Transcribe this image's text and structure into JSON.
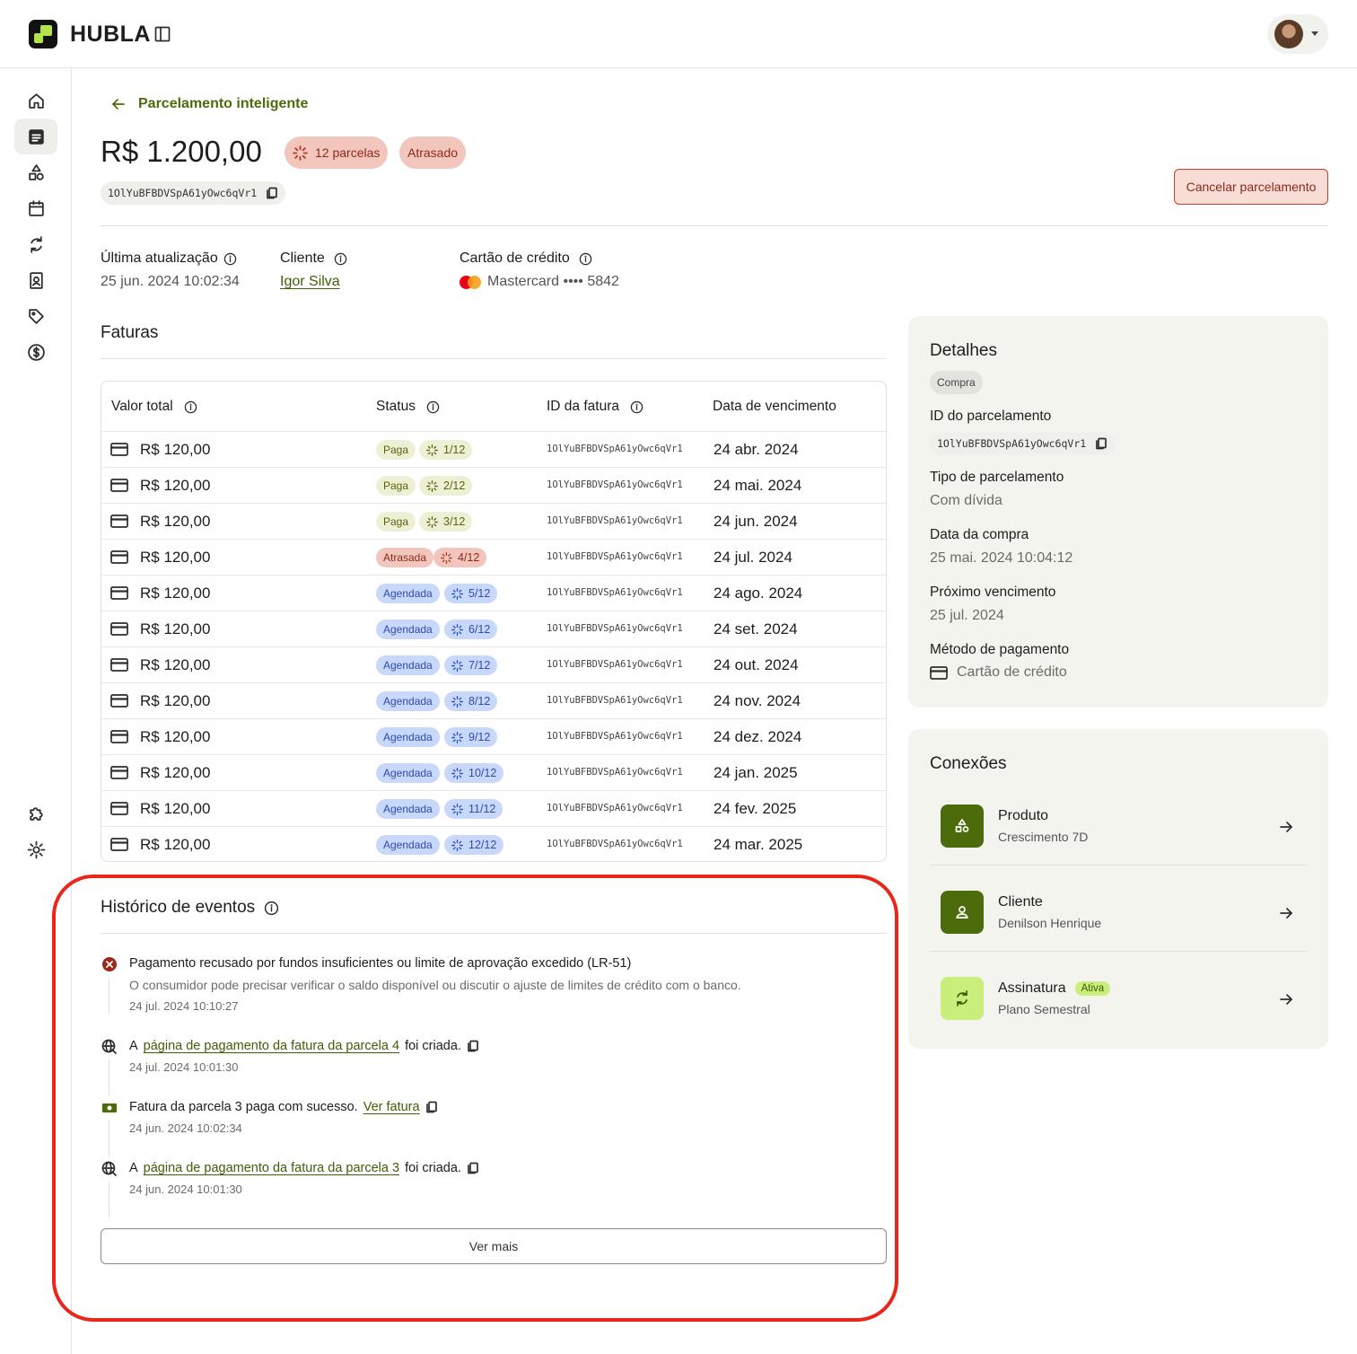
{
  "app": {
    "brand": "HUBLA",
    "logo_color": "#b4e24c"
  },
  "header": {
    "back_label": "Parcelamento inteligente",
    "amount": "R$ 1.200,00",
    "installments_badge": "12 parcelas",
    "status_badge": "Atrasado",
    "id": "1OlYuBFBDVSpA61yOwc6qVr1",
    "cancel_label": "Cancelar parcelamento"
  },
  "meta": {
    "last_update_label": "Última atualização",
    "last_update_value": "25 jun. 2024 10:02:34",
    "client_label": "Cliente",
    "client_value": "Igor Silva",
    "card_label": "Cartão de crédito",
    "card_value": "Mastercard •••• 5842"
  },
  "invoices": {
    "title": "Faturas",
    "headers": [
      "Valor total",
      "Status",
      "ID da fatura",
      "Data de vencimento"
    ],
    "rows": [
      {
        "value": "R$ 120,00",
        "status": "Paga",
        "kind": "paga",
        "parcel": "1/12",
        "id": "1OlYuBFBDVSpA61yOwc6qVr1",
        "due": "24 abr. 2024"
      },
      {
        "value": "R$ 120,00",
        "status": "Paga",
        "kind": "paga",
        "parcel": "2/12",
        "id": "1OlYuBFBDVSpA61yOwc6qVr1",
        "due": "24 mai. 2024"
      },
      {
        "value": "R$ 120,00",
        "status": "Paga",
        "kind": "paga",
        "parcel": "3/12",
        "id": "1OlYuBFBDVSpA61yOwc6qVr1",
        "due": "24 jun. 2024"
      },
      {
        "value": "R$ 120,00",
        "status": "Atrasada",
        "kind": "atr",
        "parcel": "4/12",
        "id": "1OlYuBFBDVSpA61yOwc6qVr1",
        "due": "24 jul. 2024"
      },
      {
        "value": "R$ 120,00",
        "status": "Agendada",
        "kind": "ag",
        "parcel": "5/12",
        "id": "1OlYuBFBDVSpA61yOwc6qVr1",
        "due": "24 ago. 2024"
      },
      {
        "value": "R$ 120,00",
        "status": "Agendada",
        "kind": "ag",
        "parcel": "6/12",
        "id": "1OlYuBFBDVSpA61yOwc6qVr1",
        "due": "24 set. 2024"
      },
      {
        "value": "R$ 120,00",
        "status": "Agendada",
        "kind": "ag",
        "parcel": "7/12",
        "id": "1OlYuBFBDVSpA61yOwc6qVr1",
        "due": "24 out. 2024"
      },
      {
        "value": "R$ 120,00",
        "status": "Agendada",
        "kind": "ag",
        "parcel": "8/12",
        "id": "1OlYuBFBDVSpA61yOwc6qVr1",
        "due": "24 nov. 2024"
      },
      {
        "value": "R$ 120,00",
        "status": "Agendada",
        "kind": "ag",
        "parcel": "9/12",
        "id": "1OlYuBFBDVSpA61yOwc6qVr1",
        "due": "24 dez. 2024"
      },
      {
        "value": "R$ 120,00",
        "status": "Agendada",
        "kind": "ag",
        "parcel": "10/12",
        "id": "1OlYuBFBDVSpA61yOwc6qVr1",
        "due": "24 jan. 2025"
      },
      {
        "value": "R$ 120,00",
        "status": "Agendada",
        "kind": "ag",
        "parcel": "11/12",
        "id": "1OlYuBFBDVSpA61yOwc6qVr1",
        "due": "24 fev. 2025"
      },
      {
        "value": "R$ 120,00",
        "status": "Agendada",
        "kind": "ag",
        "parcel": "12/12",
        "id": "1OlYuBFBDVSpA61yOwc6qVr1",
        "due": "24 mar. 2025"
      }
    ]
  },
  "history": {
    "title": "Histórico de eventos",
    "e1_text": "Pagamento recusado por fundos insuficientes ou limite de aprovação excedido (LR-51)",
    "e1_sub": "O consumidor pode precisar verificar o saldo disponível ou discutir o ajuste de limites de crédito com o banco.",
    "e1_time": "24 jul. 2024 10:10:27",
    "e2_pre": "A",
    "e2_link": "página de pagamento da fatura da parcela 4",
    "e2_post": "foi criada.",
    "e2_time": "24 jul. 2024 10:01:30",
    "e3_pre": "Fatura da parcela 3 paga com sucesso.",
    "e3_link": "Ver fatura",
    "e3_time": "24 jun. 2024 10:02:34",
    "e4_pre": "A",
    "e4_link": "página de pagamento da fatura da parcela 3",
    "e4_post": "foi criada.",
    "e4_time": "24 jun. 2024 10:01:30",
    "more_label": "Ver mais"
  },
  "details": {
    "title": "Detalhes",
    "chip": "Compra",
    "id_label": "ID do parcelamento",
    "id_value": "1OlYuBFBDVSpA61yOwc6qVr1",
    "type_label": "Tipo de parcelamento",
    "type_value": "Com dívida",
    "purchase_label": "Data da compra",
    "purchase_value": "25 mai. 2024 10:04:12",
    "next_label": "Próximo vencimento",
    "next_value": "25 jul. 2024",
    "method_label": "Método de pagamento",
    "method_value": "Cartão de crédito"
  },
  "connections": {
    "title": "Conexões",
    "product_title": "Produto",
    "product_sub": "Crescimento 7D",
    "client_title": "Cliente",
    "client_sub": "Denilson Henrique",
    "sub_title": "Assinatura",
    "sub_badge": "Ativa",
    "sub_sub": "Plano Semestral"
  }
}
